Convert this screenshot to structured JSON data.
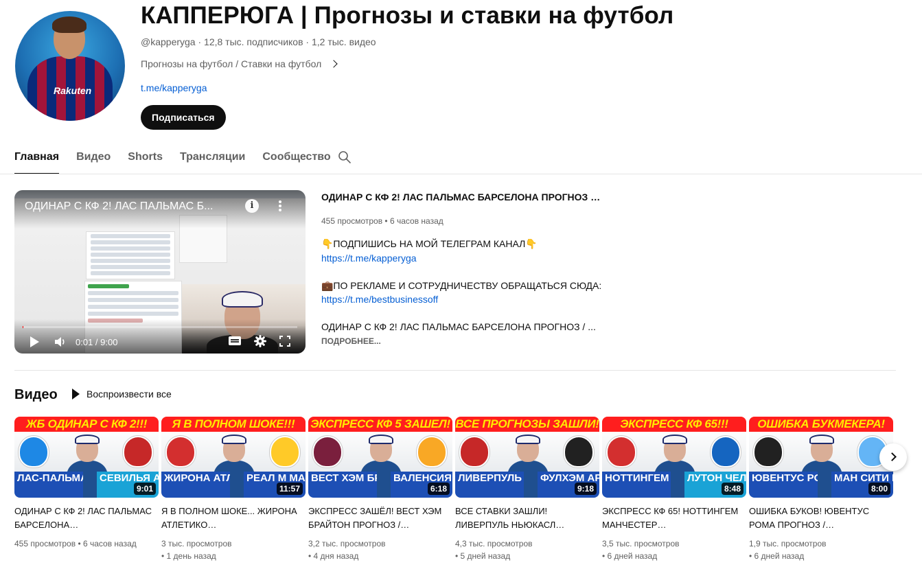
{
  "channel": {
    "title": "КАППЕРЮГА | Прогнозы и ставки на футбол",
    "handle": "@kapperyga",
    "meta_rest": " · 12,8 тыс. подписчиков · 1,2 тыс. видео",
    "description": "Прогнозы на футбол / Ставки на футбол",
    "link": "t.me/kapperyga",
    "subscribe_label": "Подписаться",
    "avatar_sponsor": "Rakuten"
  },
  "tabs": [
    {
      "label": "Главная",
      "active": true
    },
    {
      "label": "Видео",
      "active": false
    },
    {
      "label": "Shorts",
      "active": false
    },
    {
      "label": "Трансляции",
      "active": false
    },
    {
      "label": "Сообщество",
      "active": false
    }
  ],
  "featured": {
    "player_title": "ОДИНАР С КФ 2! ЛАС ПАЛЬМАС Б...",
    "time": "0:01 / 9:00",
    "progress": 0.002,
    "info_glyph": "i",
    "title": "ОДИНАР С КФ 2! ЛАС ПАЛЬМАС БАРСЕЛОНА ПРОГНОЗ / С...",
    "meta": "455 просмотров • 6 часов назад",
    "desc_line1": "👇ПОДПИШИСЬ НА МОЙ ТЕЛЕГРАМ КАНАЛ👇",
    "desc_link1": "https://t.me/kapperyga",
    "desc_line2": "💼ПО РЕКЛАМЕ И СОТРУДНИЧЕСТВУ ОБРАЩАТЬСЯ СЮДА:",
    "desc_link2": "https://t.me/bestbusinessoff",
    "desc_line3": "ОДИНАР С КФ 2! ЛАС ПАЛЬМАС БАРСЕЛОНА ПРОГНОЗ / ...",
    "more_label": "ПОДРОБНЕЕ..."
  },
  "shelf": {
    "title": "Видео",
    "play_all_label": "Воспроизвести все"
  },
  "videos": [
    {
      "banner": "ЖБ ОДИНАР С КФ 2!!!",
      "team_left": "ЛАС-ПАЛЬМАС БАРСЕЛОНА",
      "team_right": "СЕВИЛЬЯ АТЛЕТ",
      "duration": "9:01",
      "title": "ОДИНАР С КФ 2! ЛАС ПАЛЬМАС БАРСЕЛОНА…",
      "views": "455 просмотров",
      "age": "• 6 часов назад",
      "age_inline": true,
      "right_color": "#1aa3d6",
      "badge_left": "#1e88e5",
      "badge_right": "#c62828"
    },
    {
      "banner": "Я В ПОЛНОМ ШОКЕ!!!",
      "team_left": "ЖИРОНА АТЛЕТИКО",
      "team_right": "РЕАЛ М МАЛЬ",
      "duration": "11:57",
      "title": "Я В ПОЛНОМ ШОКЕ... ЖИРОНА АТЛЕТИКО…",
      "views": "3 тыс. просмотров",
      "age": "• 1 день назад",
      "age_inline": false,
      "right_color": "#1d4fb5",
      "badge_left": "#d32f2f",
      "badge_right": "#ffca28"
    },
    {
      "banner": "ЭКСПРЕСС КФ 5 ЗАШЕЛ!",
      "team_left": "ВЕСТ ХЭМ БРАЙТОН",
      "team_right": "ВАЛЕНСИЯ ВИЛЬЯР",
      "duration": "6:18",
      "title": "ЭКСПРЕСС ЗАШЁЛ! ВЕСТ ХЭМ БРАЙТОН ПРОГНОЗ /…",
      "views": "3,2 тыс. просмотров",
      "age": "• 4 дня назад",
      "age_inline": false,
      "right_color": "#1d4fb5",
      "badge_left": "#7a1f3d",
      "badge_right": "#f9a825"
    },
    {
      "banner": "ВСЕ ПРОГНОЗЫ ЗАШЛИ!",
      "team_left": "ЛИВЕРПУЛЬ НЬЮКАСЛ",
      "team_right": "ФУЛХЭМ АРСЕ",
      "duration": "9:18",
      "title": "ВСЕ СТАВКИ ЗАШЛИ! ЛИВЕРПУЛЬ НЬЮКАСЛ…",
      "views": "4,3 тыс. просмотров",
      "age": "• 5 дней назад",
      "age_inline": false,
      "right_color": "#1d4fb5",
      "badge_left": "#c62828",
      "badge_right": "#212121"
    },
    {
      "banner": "ЭКСПРЕСС КФ 65!!!",
      "team_left": "НОТТИНГЕМ МЮ",
      "team_right": "ЛУТОН ЧЕЛС",
      "duration": "8:48",
      "title": "ЭКСПРЕСС КФ 65! НОТТИНГЕМ МАНЧЕСТЕР…",
      "views": "3,5 тыс. просмотров",
      "age": "• 6 дней назад",
      "age_inline": false,
      "right_color": "#1aa3d6",
      "badge_left": "#d32f2f",
      "badge_right": "#1565c0"
    },
    {
      "banner": "ОШИБКА БУКМЕКЕРА!",
      "team_left": "ЮВЕНТУС РОМА",
      "team_right": "МАН СИТИ ШЕФФ",
      "duration": "8:00",
      "title": "ОШИБКА БУКОВ! ЮВЕНТУС РОМА ПРОГНОЗ /…",
      "views": "1,9 тыс. просмотров",
      "age": "• 6 дней назад",
      "age_inline": false,
      "right_color": "#1d4fb5",
      "badge_left": "#212121",
      "badge_right": "#64b5f6"
    }
  ]
}
